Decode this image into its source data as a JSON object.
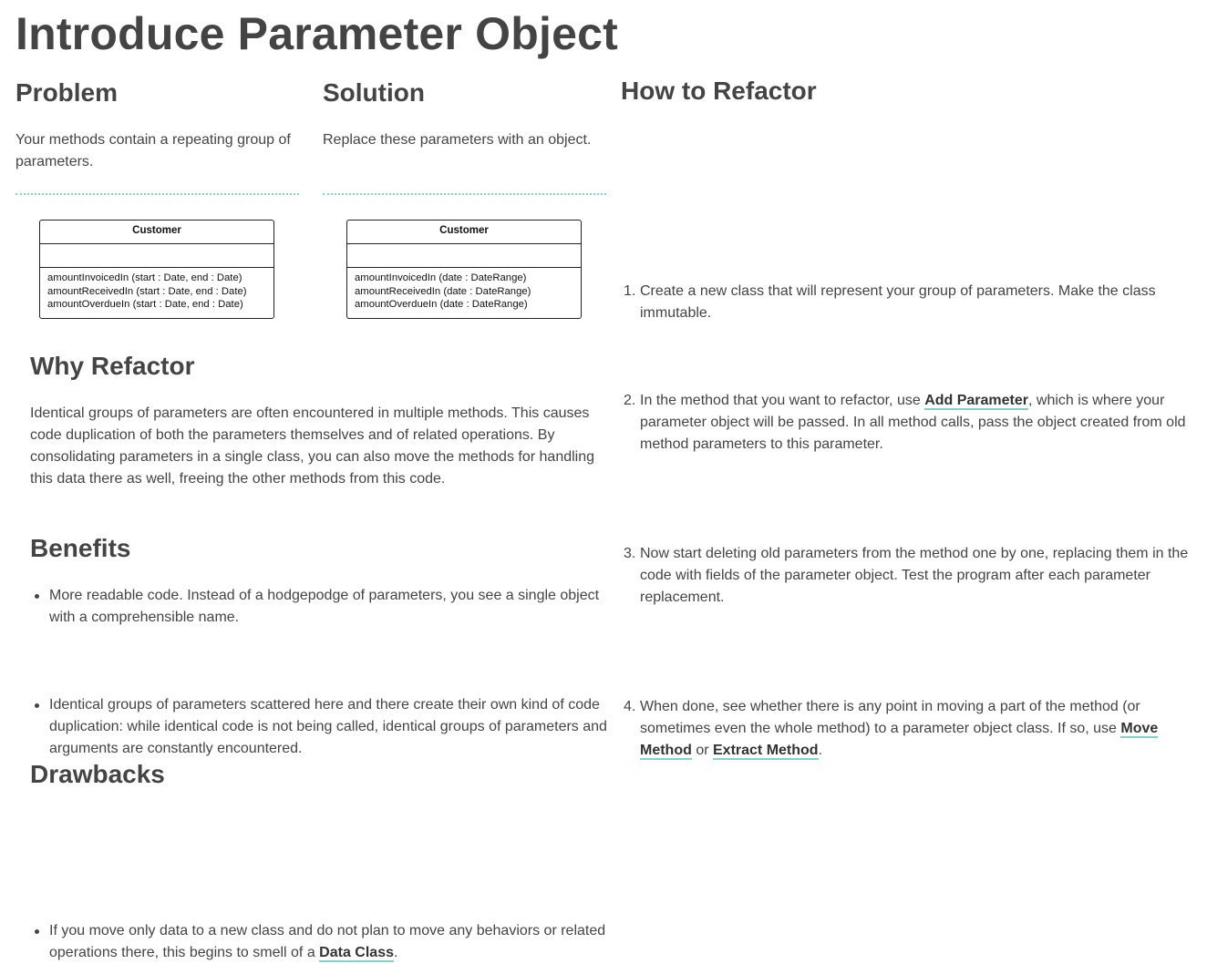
{
  "page": {
    "title": "Introduce Parameter Object",
    "accent_color": "#7fd3c8"
  },
  "problem": {
    "heading": "Problem",
    "text": "Your methods contain a repeating group of parameters.",
    "uml": {
      "class_name": "Customer",
      "methods": [
        "amountInvoicedIn (start : Date, end : Date)",
        "amountReceivedIn (start : Date, end : Date)",
        "amountOverdueIn (start : Date, end : Date)"
      ]
    }
  },
  "solution": {
    "heading": "Solution",
    "text": "Replace these parameters with an object.",
    "uml": {
      "class_name": "Customer",
      "methods": [
        "amountInvoicedIn (date : DateRange)",
        "amountReceivedIn (date : DateRange)",
        "amountOverdueIn (date : DateRange)"
      ]
    }
  },
  "why": {
    "heading": "Why Refactor",
    "text": "Identical groups of parameters are often encountered in multiple methods. This causes code duplication of both the parameters themselves and of related operations. By consolidating parameters in a single class, you can also move the methods for handling this data there as well, freeing the other methods from this code."
  },
  "benefits": {
    "heading": "Benefits",
    "items": [
      "More readable code. Instead of a hodgepodge of parameters, you see a single object with a comprehensible name.",
      "Identical groups of parameters scattered here and there create their own kind of code duplication: while identical code is not being called, identical groups of parameters and arguments are constantly encountered."
    ]
  },
  "drawbacks": {
    "heading": "Drawbacks",
    "item_before": "If you move only data to a new class and do not plan to move any behaviors or related operations there, this begins to smell of a ",
    "item_link": "Data Class",
    "item_after": "."
  },
  "how": {
    "heading": "How to Refactor",
    "steps": [
      {
        "num": "1.",
        "text": "Create a new class that will represent your group of parameters. Make the class immutable."
      },
      {
        "num": "2.",
        "before": "In the method that you want to refactor, use ",
        "link": "Add Parameter",
        "after": ", which is where your parameter object will be passed. In all method calls, pass the object created from old method parameters to this parameter."
      },
      {
        "num": "3.",
        "text": "Now start deleting old parameters from the method one by one, replacing them in the code with fields of the parameter object. Test the program after each parameter replacement."
      },
      {
        "num": "4.",
        "before": "When done, see whether there is any point in moving a part of the method (or sometimes even the whole method) to a parameter object class. If so, use ",
        "link1": "Move Method",
        "middle": " or ",
        "link2": "Extract Method",
        "after": "."
      }
    ]
  }
}
